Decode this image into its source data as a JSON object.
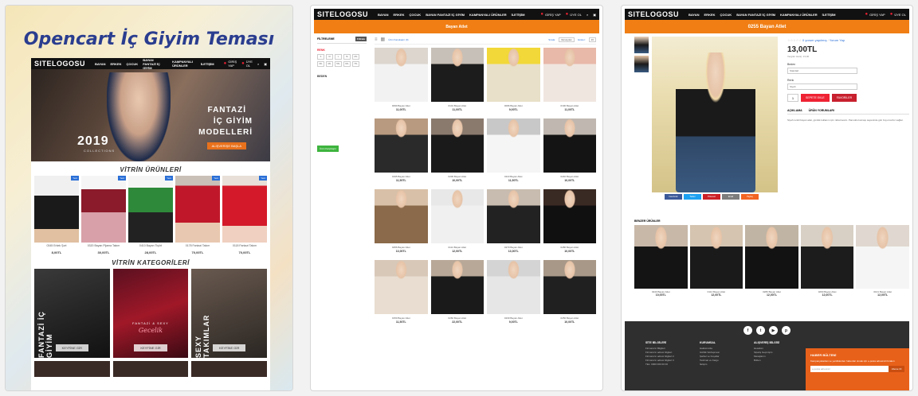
{
  "colors": {
    "accent_orange": "#f07e14",
    "nav_black": "#111111",
    "price_red": "#ee2233",
    "title_blue": "#2a3d8f",
    "footer_dark": "#2f2f2f"
  },
  "panel1": {
    "title": "Opencart İç Giyim Teması",
    "nav": {
      "logo": "SITELOGOSU",
      "items": [
        "BAYAN",
        "ERKEK",
        "ÇOCUK",
        "BAYAN FANTAZİ İÇ GİYİM",
        "KAMPANYALI ÜRÜNLER",
        "İLETİŞİM"
      ],
      "login": "GİRİŞ YAP",
      "register": "ÜYE OL"
    },
    "hero": {
      "year": "2019",
      "collection": "COLLECTIONS",
      "line1": "FANTAZİ",
      "line2": "İÇ GİYİM",
      "line3": "MODELLERİ",
      "button": "ALIŞVERİŞE BAŞLA"
    },
    "showcase_title": "VİTRİN ÜRÜNLERİ",
    "products": [
      {
        "name": "0345 Erkek Şort",
        "price": "8,00TL"
      },
      {
        "name": "0320 Bayan Pijama Takım",
        "price": "30,00TL"
      },
      {
        "name": "0410 Bayan Tişört",
        "price": "28,00TL"
      },
      {
        "name": "0178 Fantazi Takım",
        "price": "70,00TL"
      },
      {
        "name": "0118 Fantazi Takım",
        "price": "70,00TL"
      }
    ],
    "categories_title": "VİTRİN KATEGORİLERİ",
    "categories": [
      {
        "vertical": "FANTAZİ İÇ GİYİM",
        "button": "KEYFİNE GİR"
      },
      {
        "mid1": "FANTAZİ & SEXY",
        "mid2": "Gecelik",
        "button": "KEYFİNE GİR"
      },
      {
        "vertical": "SEXY TAKIMLAR",
        "button": "KEYFİNE GİR"
      }
    ]
  },
  "panel2": {
    "banner": "Bayan Atlet",
    "filter": {
      "title": "FİLTRELEME",
      "button": "Filtrele",
      "sections": [
        "RENK",
        "BEDEN"
      ],
      "sizes": [
        "S",
        "M",
        "L",
        "XL",
        "2XL",
        "3XL",
        "4XL",
        "5XL",
        "6XL",
        "7XL"
      ]
    },
    "compare": "Ürün Karşılaştır",
    "toolbar": {
      "compare_link": "Ürün Karşılaştır (0)",
      "sort_label": "Sırala:",
      "sort_value": "Varsayılan",
      "show_label": "Göster:",
      "show_value": "20"
    },
    "products": [
      {
        "name": "0090 Bayan Atlet",
        "price": "11,00TL"
      },
      {
        "name": "0101 Bayan Atlet",
        "price": "11,00TL"
      },
      {
        "name": "0096 Bayan Atlet",
        "price": "9,00TL"
      },
      {
        "name": "0190 Bayan Atlet",
        "price": "11,00TL"
      },
      {
        "name": "0195 Bayan Atlet",
        "price": "11,50TL"
      },
      {
        "name": "0206 Bayan Atlet",
        "price": "10,00TL"
      },
      {
        "name": "0110 Bayan Atlet",
        "price": "11,50TL"
      },
      {
        "name": "0240 Bayan Atlet",
        "price": "10,00TL"
      },
      {
        "name": "0256 Bayan Atlet",
        "price": "13,00TL"
      },
      {
        "name": "0114 Bayan Atlet",
        "price": "12,00TL"
      },
      {
        "name": "0270 Bayan Atlet",
        "price": "13,00TL"
      },
      {
        "name": "0280 Bayan Atlet",
        "price": "10,00TL"
      },
      {
        "name": "0150 Bayan Atlet",
        "price": "11,50TL"
      },
      {
        "name": "0260 Bayan Atlet",
        "price": "22,00TL"
      },
      {
        "name": "0230 Bayan Atlet",
        "price": "9,00TL"
      },
      {
        "name": "0250 Bayan Atlet",
        "price": "10,00TL"
      }
    ]
  },
  "panel3": {
    "banner": "0255 Bayan Atlet",
    "reviews": "0 yorum yapılmış",
    "write_review": "Yorum Yap",
    "price": "13,00TL",
    "price_sub": "Vergiler Hariç: 13,00",
    "option1_label": "Beden",
    "option1_value": "Standart",
    "option2_label": "Renk",
    "option2_value": "Siyah",
    "qty": "1",
    "cart_button": "SEPETE EKLE",
    "wish_button": "FAVORİLER",
    "tabs": [
      "AÇIKLAMA",
      "ÜRÜN YORUMLARI"
    ],
    "description": "Siyah renkli bayan atlet, günlük kullanım için rahat kesim. Pamuklu kumaşı sayesinde gün boyu konfor sağlar.",
    "share": [
      "Facebook",
      "Twitter",
      "Pinterest",
      "Email",
      "Paylaş"
    ],
    "related_title": "BENZER ÜRÜNLER",
    "related": [
      {
        "name": "0240 Bayan Atlet",
        "price": "10,00TL"
      },
      {
        "name": "0114 Bayan Atlet",
        "price": "12,00TL"
      },
      {
        "name": "0280 Bayan Atlet",
        "price": "12,00TL"
      },
      {
        "name": "0260 Bayan Atlet",
        "price": "12,00TL"
      },
      {
        "name": "0101 Bayan Atlet",
        "price": "12,00TL"
      }
    ],
    "footer": {
      "socials": [
        "f",
        "t",
        "▶",
        "p"
      ],
      "cols": [
        {
          "title": "SİTE BİLGİLERİ",
          "links": [
            "Firmanızın Bilgileri",
            "Firmanızın adresi bilgileri",
            "Firmanızın adresi bilgileri 2",
            "Firmanızın adresi bilgileri 3",
            "TEL: 0000 000 00 00"
          ]
        },
        {
          "title": "KURUMSAL",
          "links": [
            "Hakkımızda",
            "Gizlilik Sözleşmesi",
            "Şartlar ve Koşullar",
            "Teslimat ve Kargo",
            "İletişim"
          ]
        },
        {
          "title": "ALIŞVERİŞ BİLGİSİ",
          "links": [
            "Hesabım",
            "Sipariş Geçmişim",
            "Mesajlarım",
            "Bülten"
          ]
        }
      ],
      "newsletter_title": "HABER BÜLTENİ",
      "newsletter_text": "Kampanyalardan ve yeniliklerden haberdar olmak için e-posta adresinizi bırakın",
      "newsletter_placeholder": "e-posta adresiniz",
      "newsletter_button": "Abone Ol"
    }
  }
}
